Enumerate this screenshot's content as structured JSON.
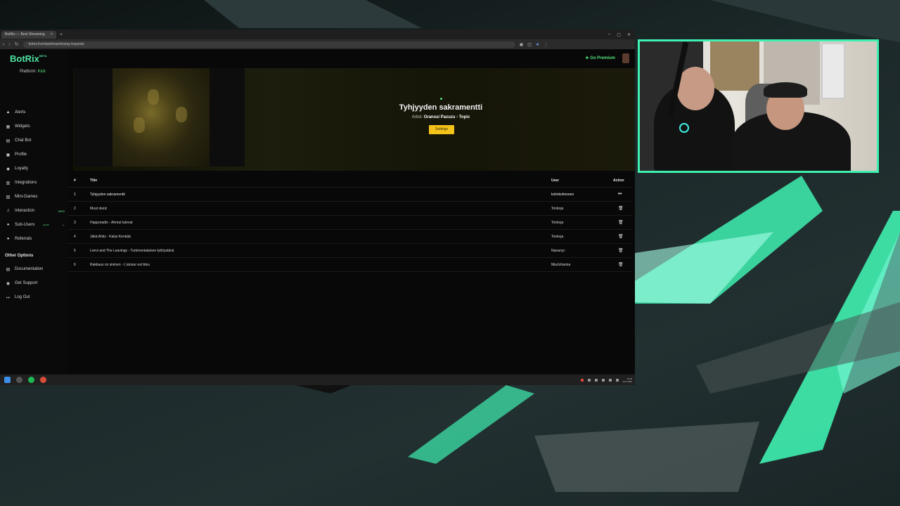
{
  "browser": {
    "tab_title": "BotRix — Best Streaming",
    "tab_close": "×",
    "new_tab": "+",
    "url": "botrix.live/dashboard/song-requests",
    "controls": [
      "–",
      "▢",
      "✕"
    ]
  },
  "sidebar": {
    "logo": "BotRix",
    "logo_sup": "BETA",
    "platform_label": "Platform:",
    "platform_value": "Kick",
    "items": [
      {
        "label": "Alerts",
        "icon": "bell-icon",
        "glyph": "▲"
      },
      {
        "label": "Widgets",
        "icon": "widgets-icon",
        "glyph": "▦"
      },
      {
        "label": "Chat Bot",
        "icon": "chat-icon",
        "glyph": "▤"
      },
      {
        "label": "Profile",
        "icon": "profile-icon",
        "glyph": "▣"
      },
      {
        "label": "Loyalty",
        "icon": "loyalty-icon",
        "glyph": "◆"
      },
      {
        "label": "Integrations",
        "icon": "integrations-icon",
        "glyph": "▥"
      },
      {
        "label": "Mini-Games",
        "icon": "games-icon",
        "glyph": "▧"
      },
      {
        "label": "Interaction",
        "icon": "music-icon",
        "glyph": "♫",
        "badge": "NEW"
      },
      {
        "label": "Sub-Users",
        "icon": "users-icon",
        "glyph": "●",
        "badge": "ELITE",
        "chevron": "⌄"
      },
      {
        "label": "Referrals",
        "icon": "referrals-icon",
        "glyph": "●"
      }
    ],
    "other_title": "Other Options",
    "other_items": [
      {
        "label": "Documentation",
        "icon": "docs-icon",
        "glyph": "▤"
      },
      {
        "label": "Get Support",
        "icon": "support-icon",
        "glyph": "◉"
      },
      {
        "label": "Log Out",
        "icon": "logout-icon",
        "glyph": "↦"
      }
    ]
  },
  "header": {
    "go_premium": "★ Go Premium"
  },
  "now_playing": {
    "title": "Tyhjyyden sakramentti",
    "artist_label": "Artist:",
    "artist": "Oranssi Pazuzu - Topic",
    "settings_button": "Settings"
  },
  "queue": {
    "headers": {
      "num": "#",
      "title": "Title",
      "user": "User",
      "action": "Action"
    },
    "rows": [
      {
        "num": "1",
        "title": "Tyhjyyden sakramentti",
        "user": "kolmkolmonen",
        "action": "⏭"
      },
      {
        "num": "2",
        "title": "Muut okeiz",
        "user": "Tonkoja",
        "action": "🗑"
      },
      {
        "num": "3",
        "title": "Happoradio - Ahmat tulevat",
        "user": "Tonkoja",
        "action": "🗑"
      },
      {
        "num": "4",
        "title": "Jäkä Ahtiz - Kaksi Kenkää",
        "user": "Tonkoja",
        "action": "🗑"
      },
      {
        "num": "5",
        "title": "Leevi and The Leavings - Turkmenialainen tyttöystävä",
        "user": "Nananyc",
        "action": "🗑"
      },
      {
        "num": "6",
        "title": "Rakkaus on sininen - L'amour est bleu",
        "user": "MiaJohanna",
        "action": "🗑"
      }
    ]
  },
  "taskbar": {
    "time": "11:06",
    "date": "10.6.2024"
  },
  "colors": {
    "accent": "#4ee3a0",
    "settings_button": "#f3c21b",
    "webcam_border": "#3ff0b0"
  }
}
